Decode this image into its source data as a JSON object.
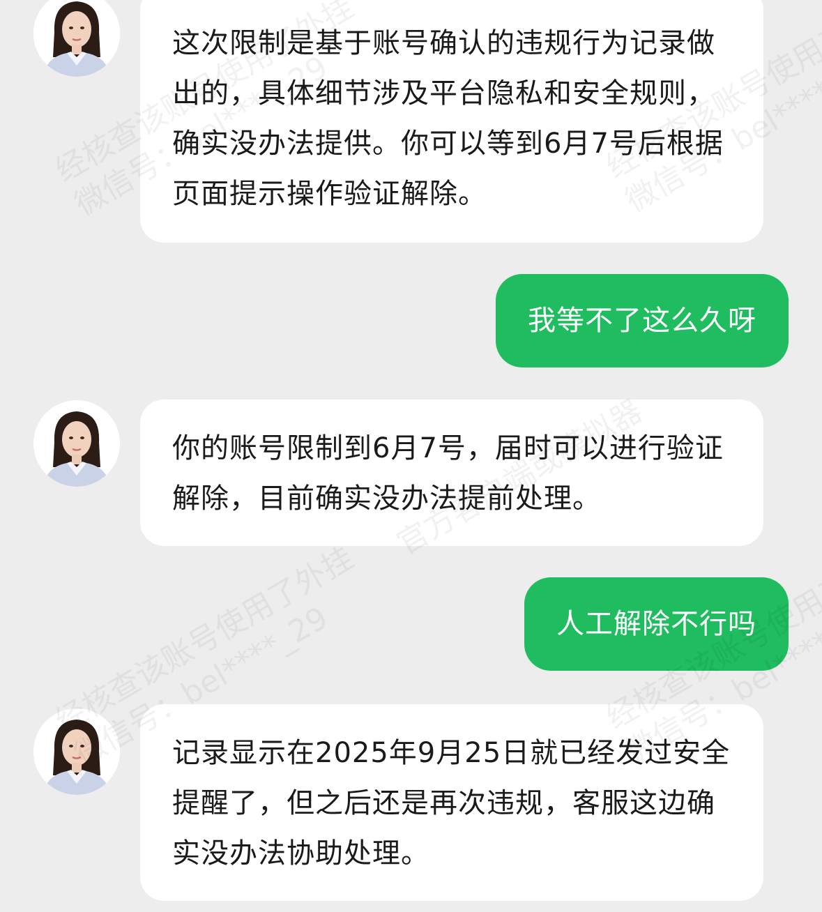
{
  "messages": [
    {
      "from": "agent",
      "text": "这次限制是基于账号确认的违规行为记录做出的，具体细节涉及平台隐私和安全规则，确实没办法提供。你可以等到6月7号后根据页面提示操作验证解除。"
    },
    {
      "from": "user",
      "text": "我等不了这么久呀"
    },
    {
      "from": "agent",
      "text": "你的账号限制到6月7号，届时可以进行验证解除，目前确实没办法提前处理。"
    },
    {
      "from": "user",
      "text": "人工解除不行吗"
    },
    {
      "from": "agent",
      "text": "记录显示在2025年9月25日就已经发过安全提醒了，但之后还是再次违规，客服这边确实没办法协助处理。"
    }
  ],
  "watermark": {
    "line1": "经核查该账号使用了外挂",
    "line2": "微信号：bel****_29",
    "line3": "官方客户端或模拟器"
  },
  "colors": {
    "background": "#ededed",
    "incoming_bubble": "#ffffff",
    "outgoing_bubble": "#1fbd5f"
  }
}
